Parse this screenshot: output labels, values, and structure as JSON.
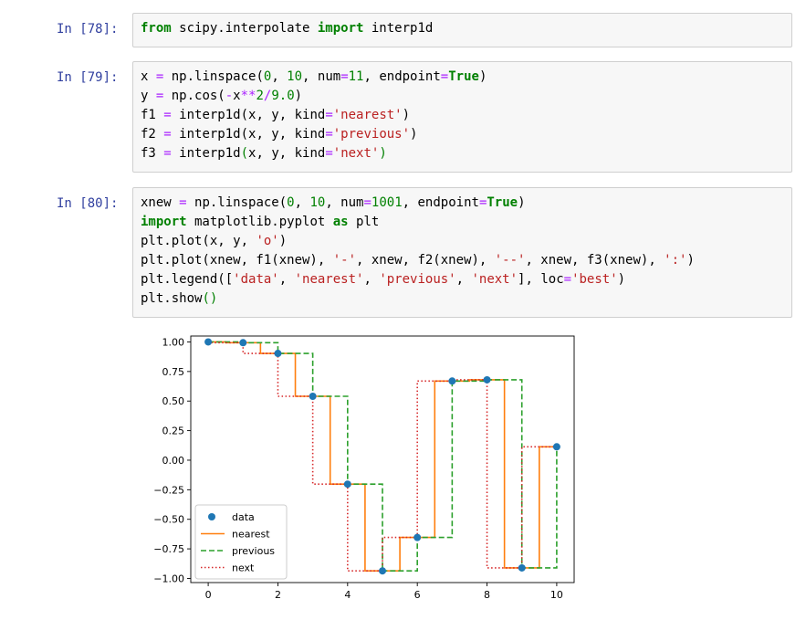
{
  "cells": [
    {
      "prompt": "In [78]:",
      "lines": [
        [
          [
            "k",
            "from"
          ],
          [
            "n",
            " scipy.interpolate "
          ],
          [
            "k",
            "import"
          ],
          [
            "n",
            " interp1d"
          ]
        ]
      ]
    },
    {
      "prompt": "In [79]:",
      "lines": [
        [
          [
            "n",
            "x "
          ],
          [
            "o",
            "="
          ],
          [
            "n",
            " np.linspace("
          ],
          [
            "m",
            "0"
          ],
          [
            "n",
            ", "
          ],
          [
            "m",
            "10"
          ],
          [
            "n",
            ", num"
          ],
          [
            "o",
            "="
          ],
          [
            "m",
            "11"
          ],
          [
            "n",
            ", endpoint"
          ],
          [
            "o",
            "="
          ],
          [
            "k",
            "True"
          ],
          [
            "n",
            ")"
          ]
        ],
        [
          [
            "n",
            "y "
          ],
          [
            "o",
            "="
          ],
          [
            "n",
            " np.cos("
          ],
          [
            "o",
            "-"
          ],
          [
            "n",
            "x"
          ],
          [
            "o",
            "**"
          ],
          [
            "m",
            "2"
          ],
          [
            "o",
            "/"
          ],
          [
            "m",
            "9.0"
          ],
          [
            "n",
            ")"
          ]
        ],
        [
          [
            "n",
            "f1 "
          ],
          [
            "o",
            "="
          ],
          [
            "n",
            " interp1d(x, y, kind"
          ],
          [
            "o",
            "="
          ],
          [
            "s",
            "'nearest'"
          ],
          [
            "n",
            ")"
          ]
        ],
        [
          [
            "n",
            "f2 "
          ],
          [
            "o",
            "="
          ],
          [
            "n",
            " interp1d(x, y, kind"
          ],
          [
            "o",
            "="
          ],
          [
            "s",
            "'previous'"
          ],
          [
            "n",
            ")"
          ]
        ],
        [
          [
            "n",
            "f3 "
          ],
          [
            "o",
            "="
          ],
          [
            "n",
            " interp1d"
          ],
          [
            "m",
            "("
          ],
          [
            "n",
            "x, y, kind"
          ],
          [
            "o",
            "="
          ],
          [
            "s",
            "'next'"
          ],
          [
            "m",
            ")"
          ]
        ]
      ]
    },
    {
      "prompt": "In [80]:",
      "lines": [
        [
          [
            "n",
            "xnew "
          ],
          [
            "o",
            "="
          ],
          [
            "n",
            " np.linspace("
          ],
          [
            "m",
            "0"
          ],
          [
            "n",
            ", "
          ],
          [
            "m",
            "10"
          ],
          [
            "n",
            ", num"
          ],
          [
            "o",
            "="
          ],
          [
            "m",
            "1001"
          ],
          [
            "n",
            ", endpoint"
          ],
          [
            "o",
            "="
          ],
          [
            "k",
            "True"
          ],
          [
            "n",
            ")"
          ]
        ],
        [
          [
            "k",
            "import"
          ],
          [
            "n",
            " matplotlib.pyplot "
          ],
          [
            "k",
            "as"
          ],
          [
            "n",
            " plt"
          ]
        ],
        [
          [
            "n",
            "plt.plot(x, y, "
          ],
          [
            "s",
            "'o'"
          ],
          [
            "n",
            ")"
          ]
        ],
        [
          [
            "n",
            "plt.plot(xnew, f1(xnew), "
          ],
          [
            "s",
            "'-'"
          ],
          [
            "n",
            ", xnew, f2(xnew), "
          ],
          [
            "s",
            "'--'"
          ],
          [
            "n",
            ", xnew, f3(xnew), "
          ],
          [
            "s",
            "':'"
          ],
          [
            "n",
            ")"
          ]
        ],
        [
          [
            "n",
            "plt.legend(["
          ],
          [
            "s",
            "'data'"
          ],
          [
            "n",
            ", "
          ],
          [
            "s",
            "'nearest'"
          ],
          [
            "n",
            ", "
          ],
          [
            "s",
            "'previous'"
          ],
          [
            "n",
            ", "
          ],
          [
            "s",
            "'next'"
          ],
          [
            "n",
            "], loc"
          ],
          [
            "o",
            "="
          ],
          [
            "s",
            "'best'"
          ],
          [
            "n",
            ")"
          ]
        ],
        [
          [
            "n",
            "plt.show"
          ],
          [
            "m",
            "()"
          ]
        ]
      ]
    }
  ],
  "chart_data": {
    "type": "line",
    "x": [
      0,
      1,
      2,
      3,
      4,
      5,
      6,
      7,
      8,
      9,
      10
    ],
    "y": [
      1.0,
      0.9938,
      0.9028,
      0.5403,
      -0.2026,
      -0.9364,
      -0.6536,
      0.6693,
      0.6795,
      -0.9111,
      0.1134
    ],
    "series": [
      {
        "name": "data",
        "style": "o",
        "color": "#1f77b4"
      },
      {
        "name": "nearest",
        "style": "-",
        "color": "#ff7f0e"
      },
      {
        "name": "previous",
        "style": "--",
        "color": "#2ca02c"
      },
      {
        "name": "next",
        "style": ":",
        "color": "#d62728"
      }
    ],
    "xlim": [
      -0.5,
      10.5
    ],
    "ylim": [
      -1.035,
      1.05
    ],
    "xticks": [
      "0",
      "2",
      "4",
      "6",
      "8",
      "10"
    ],
    "yticks": [
      "1.00",
      "0.75",
      "0.50",
      "0.25",
      "0.00",
      "−0.25",
      "−0.50",
      "−0.75",
      "−1.00"
    ],
    "legend_loc": "lower-left",
    "grid": false
  }
}
